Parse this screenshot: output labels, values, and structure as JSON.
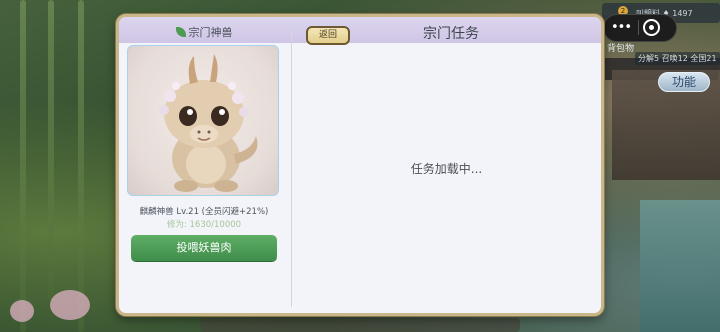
{
  "hud": {
    "top_text": "叫鏡料 ♦ 1497",
    "badge_count": "2",
    "bag_label": "背包物",
    "stats_label": "分解5 召唤12 全国21",
    "function_button": "功能"
  },
  "dialog": {
    "left_title": "宗门神兽",
    "pet_name": "麒麟神兽 Lv.21 (全员闪避+21%)",
    "pet_xp": "修为: 1630/10000",
    "feed_button": "投喂妖兽肉",
    "back_button": "返回",
    "title": "宗门任务",
    "loading_text": "任务加载中..."
  },
  "colors": {
    "dialog_border": "#c9b68a",
    "header_band": "#d6cfec",
    "feed_button_green": "#4f9c58",
    "back_button_gold": "#ead89f",
    "xp_text": "#a8c59a"
  },
  "icons": [
    "leaf-icon",
    "more-dots-icon",
    "target-icon",
    "dragon-pet-image"
  ]
}
